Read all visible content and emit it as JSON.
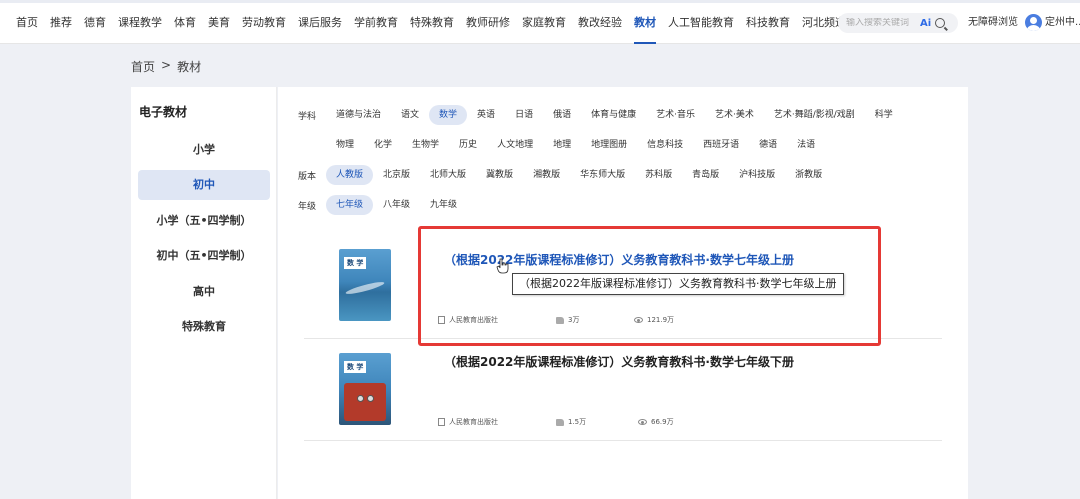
{
  "nav": {
    "items": [
      "首页",
      "推荐",
      "德育",
      "课程教学",
      "体育",
      "美育",
      "劳动教育",
      "课后服务",
      "学前教育",
      "特殊教育",
      "教师研修",
      "家庭教育",
      "教改经验",
      "教材",
      "人工智能教育",
      "科技教育",
      "河北频道"
    ],
    "active": "教材",
    "search_placeholder": "输入搜索关键词",
    "ai_label": "Ai",
    "accessibility": "无障碍浏览",
    "username": "定州中..."
  },
  "breadcrumb": {
    "home": "首页",
    "sep": ">",
    "current": "教材"
  },
  "sidebar": {
    "title": "电子教材",
    "items": [
      "小学",
      "初中",
      "小学（五•四学制）",
      "初中（五•四学制）",
      "高中",
      "特殊教育"
    ],
    "active": "初中"
  },
  "filters": {
    "subject_label": "学科",
    "subjects_row1": [
      "道德与法治",
      "语文",
      "数学",
      "英语",
      "日语",
      "俄语",
      "体育与健康",
      "艺术·音乐",
      "艺术·美术",
      "艺术·舞蹈/影视/戏剧",
      "科学"
    ],
    "subjects_row2": [
      "物理",
      "化学",
      "生物学",
      "历史",
      "人文地理",
      "地理",
      "地理图册",
      "信息科技",
      "西班牙语",
      "德语",
      "法语"
    ],
    "subject_active": "数学",
    "edition_label": "版本",
    "editions": [
      "人教版",
      "北京版",
      "北师大版",
      "冀教版",
      "湘教版",
      "华东师大版",
      "苏科版",
      "青岛版",
      "沪科技版",
      "浙教版"
    ],
    "edition_active": "人教版",
    "grade_label": "年级",
    "grades": [
      "七年级",
      "八年级",
      "九年级"
    ],
    "grade_active": "七年级"
  },
  "books": [
    {
      "title": "（根据2022年版课程标准修订）义务教育教科书·数学七年级上册",
      "cover_label": "数 学",
      "publisher": "人民教育出版社",
      "likes": "3万",
      "views": "121.9万"
    },
    {
      "title": "（根据2022年版课程标准修订）义务教育教科书·数学七年级下册",
      "cover_label": "数 学",
      "publisher": "人民教育出版社",
      "likes": "1.5万",
      "views": "66.9万"
    }
  ],
  "tooltip": "（根据2022年版课程标准修订）义务教育教科书·数学七年级上册",
  "colors": {
    "accent": "#1f57b8",
    "highlight": "#e53935",
    "active_bg": "#dfe6f4"
  }
}
